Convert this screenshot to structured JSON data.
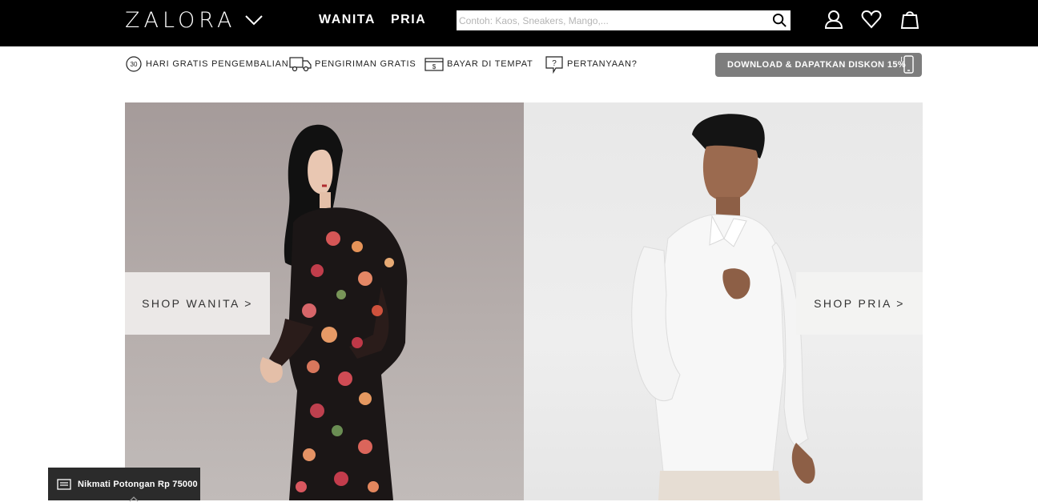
{
  "header": {
    "logo": "ZALORA",
    "nav": [
      {
        "label": "WANITA"
      },
      {
        "label": "PRIA"
      }
    ],
    "search": {
      "placeholder": "Contoh: Kaos, Sneakers, Mango,...",
      "value": ""
    },
    "icons": [
      "account-icon",
      "wishlist-icon",
      "shopping-bag-icon"
    ]
  },
  "usp": [
    {
      "icon": "30-days-return-icon",
      "badge": "30",
      "label": "HARI GRATIS PENGEMBALIAN"
    },
    {
      "icon": "delivery-truck-icon",
      "label": "PENGIRIMAN GRATIS"
    },
    {
      "icon": "cash-on-delivery-icon",
      "label": "BAYAR DI TEMPAT"
    },
    {
      "icon": "question-icon",
      "label": "PERTANYAAN?"
    }
  ],
  "download": {
    "label": "DOWNLOAD & DAPATKAN DISKON 15%",
    "icon": "mobile-phone-icon"
  },
  "hero": {
    "left": {
      "cta": "SHOP WANITA >"
    },
    "right": {
      "cta": "SHOP PRIA >"
    }
  },
  "promo": {
    "label": "Nikmati Potongan Rp 75000",
    "icon": "voucher-icon"
  },
  "colors": {
    "topbar": "#000000",
    "download_button": "#7d7d7d",
    "promo_bg": "#2b2b2b"
  }
}
